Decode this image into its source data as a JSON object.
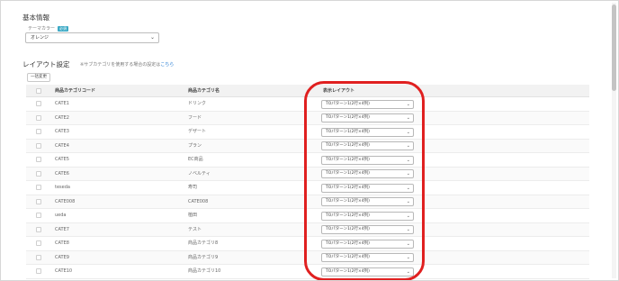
{
  "basic_info": {
    "title": "基本情報",
    "theme_label": "テーマカラー",
    "theme_badge": "必須",
    "theme_value": "オレンジ"
  },
  "layout": {
    "title": "レイアウト設定",
    "note": "※サブカテゴリを使用する場合の設定は",
    "note_link": "こちら",
    "bulk_button": "一括変更"
  },
  "table": {
    "headers": {
      "code": "商品カテゴリコード",
      "name": "商品カテゴリ名",
      "layout": "表示レイアウト"
    },
    "rows": [
      {
        "code": "CATE1",
        "name": "ドリンク",
        "layout": "TOパターン1(2行×4列)"
      },
      {
        "code": "CATE2",
        "name": "フード",
        "layout": "TOパターン1(2行×4列)"
      },
      {
        "code": "CATE3",
        "name": "デザート",
        "layout": "TOパターン1(2行×4列)"
      },
      {
        "code": "CATE4",
        "name": "プラン",
        "layout": "TOパターン1(2行×4列)"
      },
      {
        "code": "CATE5",
        "name": "EC商品",
        "layout": "TOパターン1(2行×4列)"
      },
      {
        "code": "CATE6",
        "name": "ノベルティ",
        "layout": "TOパターン1(2行×4列)"
      },
      {
        "code": "teseda",
        "name": "寿司",
        "layout": "TOパターン1(2行×4列)"
      },
      {
        "code": "CATE008",
        "name": "CATE008",
        "layout": "TOパターン1(2行×4列)"
      },
      {
        "code": "ueda",
        "name": "植田",
        "layout": "TOパターン1(2行×4列)"
      },
      {
        "code": "CATE7",
        "name": "テスト",
        "layout": "TOパターン1(2行×4列)"
      },
      {
        "code": "CATE8",
        "name": "商品カテゴリ8",
        "layout": "TOパターン1(2行×4列)"
      },
      {
        "code": "CATE9",
        "name": "商品カテゴリ9",
        "layout": "TOパターン1(2行×4列)"
      },
      {
        "code": "CATE10",
        "name": "商品カテゴリ10",
        "layout": "TOパターン1(2行×4列)"
      }
    ]
  },
  "colors": {
    "highlight": "#e02020",
    "badge": "#3ba9c5",
    "link": "#2a7fd4"
  }
}
